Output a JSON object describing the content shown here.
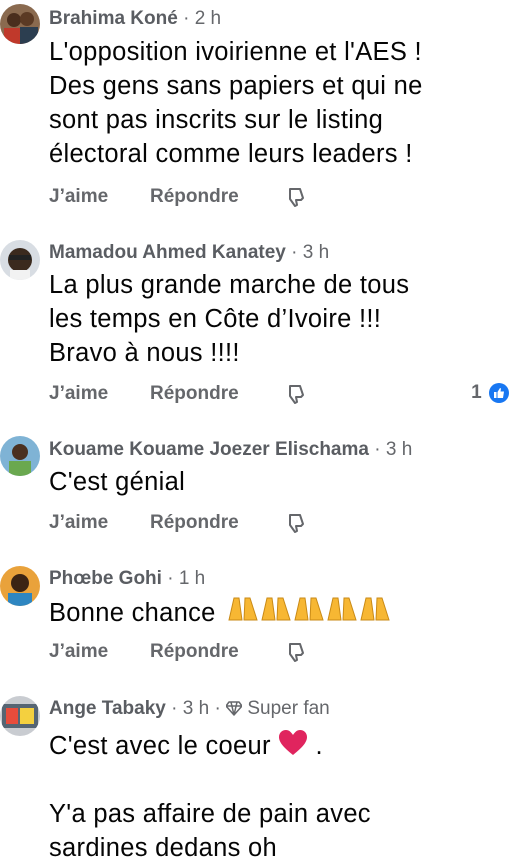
{
  "colors": {
    "text_primary": "#050505",
    "text_secondary": "#65676b",
    "like_blue": "#1877f2",
    "heart_red": "#e0245e",
    "pray_yellow": "#f7b733"
  },
  "actions": {
    "like_label": "J’aime",
    "reply_label": "Répondre",
    "like_icon": "thumbs-down-outline-icon"
  },
  "comments": [
    {
      "author": "Brahima Koné",
      "time": "2 h",
      "lines": [
        "L'opposition ivoirienne et l'AES !",
        "Des gens sans papiers et qui ne",
        "sont pas inscrits sur le listing",
        "électoral comme leurs leaders !"
      ]
    },
    {
      "author": "Mamadou Ahmed Kanatey",
      "time": "3 h",
      "lines": [
        "La plus grande marche de tous",
        "les temps en Côte d’Ivoire !!!",
        "Bravo à nous !!!!"
      ],
      "reaction_count": "1",
      "reaction_icon": "like-reaction-icon"
    },
    {
      "author": "Kouame Kouame Joezer Elischama",
      "time": "3 h",
      "lines": [
        "C'est génial"
      ]
    },
    {
      "author": "Phœbe Gohi",
      "time": "1 h",
      "lines": [
        "Bonne chance"
      ],
      "emoji_icon": "folded-hands-emoji"
    },
    {
      "author": "Ange Tabaky",
      "time": "3 h",
      "badge": "Super fan",
      "badge_icon": "diamond-icon",
      "lines": [
        "C'est avec le coeur",
        "",
        "Y'a pas affaire de pain avec",
        "sardines dedans oh"
      ],
      "emoji_icon": "red-heart-emoji"
    }
  ]
}
